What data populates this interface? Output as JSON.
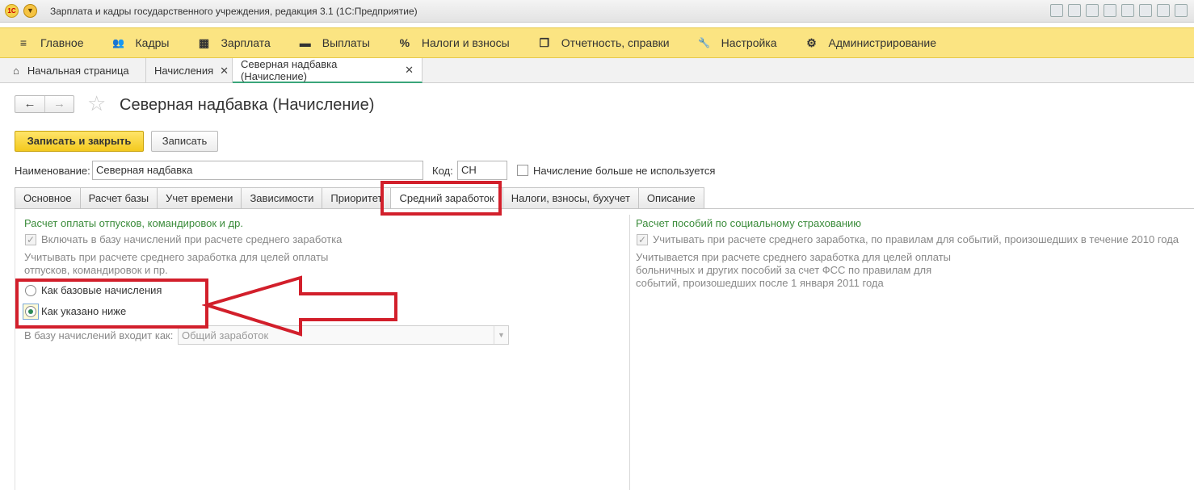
{
  "window": {
    "title": "Зарплата и кадры государственного учреждения, редакция 3.1  (1С:Предприятие)",
    "logo_text": "1С"
  },
  "main_menu": [
    {
      "label": "Главное",
      "icon": "menu-icon",
      "glyph": "≡"
    },
    {
      "label": "Кадры",
      "icon": "people-icon",
      "glyph": "👥"
    },
    {
      "label": "Зарплата",
      "icon": "calculator-icon",
      "glyph": "▦"
    },
    {
      "label": "Выплаты",
      "icon": "wallet-icon",
      "glyph": "▬"
    },
    {
      "label": "Налоги и взносы",
      "icon": "percent-icon",
      "glyph": "%"
    },
    {
      "label": "Отчетность, справки",
      "icon": "reports-icon",
      "glyph": "❐"
    },
    {
      "label": "Настройка",
      "icon": "wrench-icon",
      "glyph": "🔧"
    },
    {
      "label": "Администрирование",
      "icon": "gear-icon",
      "glyph": "⚙"
    }
  ],
  "window_tabs": [
    {
      "label": "Начальная страница"
    },
    {
      "label": "Начисления"
    },
    {
      "label": "Северная надбавка (Начисление)"
    }
  ],
  "form": {
    "title": "Северная надбавка (Начисление)",
    "save_close": "Записать и закрыть",
    "save": "Записать",
    "name_label": "Наименование:",
    "name_value": "Северная надбавка",
    "code_label": "Код:",
    "code_value": "СН",
    "unused_label": "Начисление больше не используется"
  },
  "form_tabs": [
    "Основное",
    "Расчет базы",
    "Учет времени",
    "Зависимости",
    "Приоритет",
    "Средний заработок",
    "Налоги, взносы, бухучет",
    "Описание"
  ],
  "left_panel": {
    "group_title": "Расчет оплаты отпусков, командировок и др.",
    "include_label": "Включать в базу начислений при расчете среднего заработка",
    "note_line1": "Учитывать при расчете среднего заработка для целей оплаты",
    "note_line2": "отпусков, командировок и пр.",
    "radio1": "Как базовые начисления",
    "radio2": "Как указано ниже",
    "base_label": "В базу начислений входит как:",
    "base_value": "Общий заработок"
  },
  "right_panel": {
    "group_title": "Расчет пособий по социальному страхованию",
    "check_label": "Учитывать при расчете среднего заработка, по правилам для событий, произошедших в течение 2010 года",
    "note_line1": "Учитывается при расчете среднего заработка для целей оплаты",
    "note_line2": "больничных и других пособий за счет ФСС по правилам для",
    "note_line3": "событий, произошедших после 1 января 2011 года"
  },
  "colors": {
    "menu_bg": "#fbe482",
    "accent_green": "#3b8c3b",
    "annotation_red": "#d21f2b"
  }
}
